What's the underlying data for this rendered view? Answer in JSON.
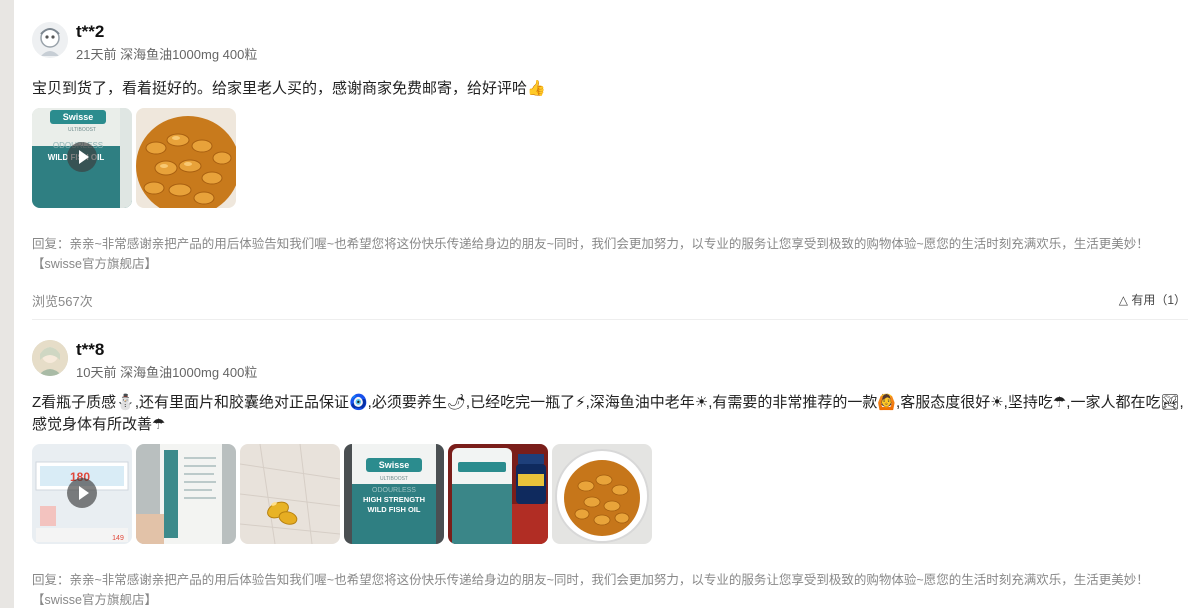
{
  "reviews": [
    {
      "user": "t**2",
      "meta": "21天前 深海鱼油1000mg 400粒",
      "text": "宝贝到货了，看着挺好的。给家里老人买的，感谢商家免费邮寄，给好评哈👍",
      "reply": "回复：亲亲~非常感谢亲把产品的用后体验告知我们喔~也希望您将这份快乐传递给身边的朋友~同时，我们会更加努力，以专业的服务让您享受到极致的购物体验~愿您的生活时刻充满欢乐，生活更美妙！【swisse官方旗舰店】",
      "views": "浏览567次",
      "useful": "有用（1）",
      "bottle_brand": "Swisse",
      "bottle_sub": "ULTIBOOST",
      "bottle_line1": "ODOURLESS",
      "bottle_line2": "WILD FISH OIL"
    },
    {
      "user": "t**8",
      "meta": "10天前 深海鱼油1000mg 400粒",
      "text": "Z看瓶子质感⛄,还有里面片和胶囊绝对正品保证🧿,必须要养生🌶,已经吃完一瓶了⚡,深海鱼油中老年☀,有需要的非常推荐的一款🙆,客服态度很好☀,坚持吃☂,一家人都在吃🏞,感觉身体有所改善☂",
      "reply": "回复：亲亲~非常感谢亲把产品的用后体验告知我们喔~也希望您将这份快乐传递给身边的朋友~同时，我们会更加努力，以专业的服务让您享受到极致的购物体验~愿您的生活时刻充满欢乐，生活更美妙！【swisse官方旗舰店】",
      "video_price": "180",
      "video_price2": "149",
      "bottle_brand": "Swisse",
      "bottle_sub": "ULTIBOOST",
      "bottle_line1": "ODOURLESS",
      "bottle_line2": "HIGH STRENGTH",
      "bottle_line3": "WILD FISH OIL"
    }
  ]
}
